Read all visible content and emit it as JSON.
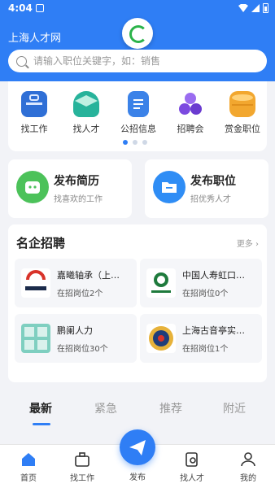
{
  "status": {
    "time": "4:04"
  },
  "header": {
    "city": "上海人才网",
    "search_placeholder": "请输入职位关键字，如：销售"
  },
  "categories": [
    {
      "label": "找工作",
      "icon": "briefcase-icon",
      "color": "#2f6fd6"
    },
    {
      "label": "找人才",
      "icon": "graduation-cap-icon",
      "color": "#27b39b"
    },
    {
      "label": "公招信息",
      "icon": "document-icon",
      "color": "#3b82e8"
    },
    {
      "label": "招聘会",
      "icon": "people-icon",
      "color": "#7c4ae0"
    },
    {
      "label": "赏金职位",
      "icon": "coin-stack-icon",
      "color": "#f2a72f"
    }
  ],
  "publish": [
    {
      "title": "发布简历",
      "subtitle": "找喜欢的工作",
      "icon": "resume-icon",
      "color": "#4cc25a"
    },
    {
      "title": "发布职位",
      "subtitle": "招优秀人才",
      "icon": "folder-icon",
      "color": "#2f8df5"
    }
  ],
  "famous": {
    "title": "名企招聘",
    "more": "更多",
    "companies": [
      {
        "name": "嘉曦轴承（上…",
        "jobs": "在招岗位2个",
        "logo": "jiaxi-logo"
      },
      {
        "name": "中国人寿虹口…",
        "jobs": "在招岗位0个",
        "logo": "china-life-logo"
      },
      {
        "name": "鹏阑人力",
        "jobs": "在招岗位30个",
        "logo": "penglan-logo"
      },
      {
        "name": "上海古音亭实…",
        "jobs": "在招岗位1个",
        "logo": "guyinting-logo"
      }
    ]
  },
  "tabs": [
    "最新",
    "紧急",
    "推荐",
    "附近"
  ],
  "bottom_nav": [
    {
      "label": "首页",
      "icon": "home-icon"
    },
    {
      "label": "找工作",
      "icon": "briefcase-icon"
    },
    {
      "label": "发布",
      "icon": "send-icon"
    },
    {
      "label": "找人才",
      "icon": "search-doc-icon"
    },
    {
      "label": "我的",
      "icon": "user-icon"
    }
  ],
  "accent": "#2f7ef5"
}
